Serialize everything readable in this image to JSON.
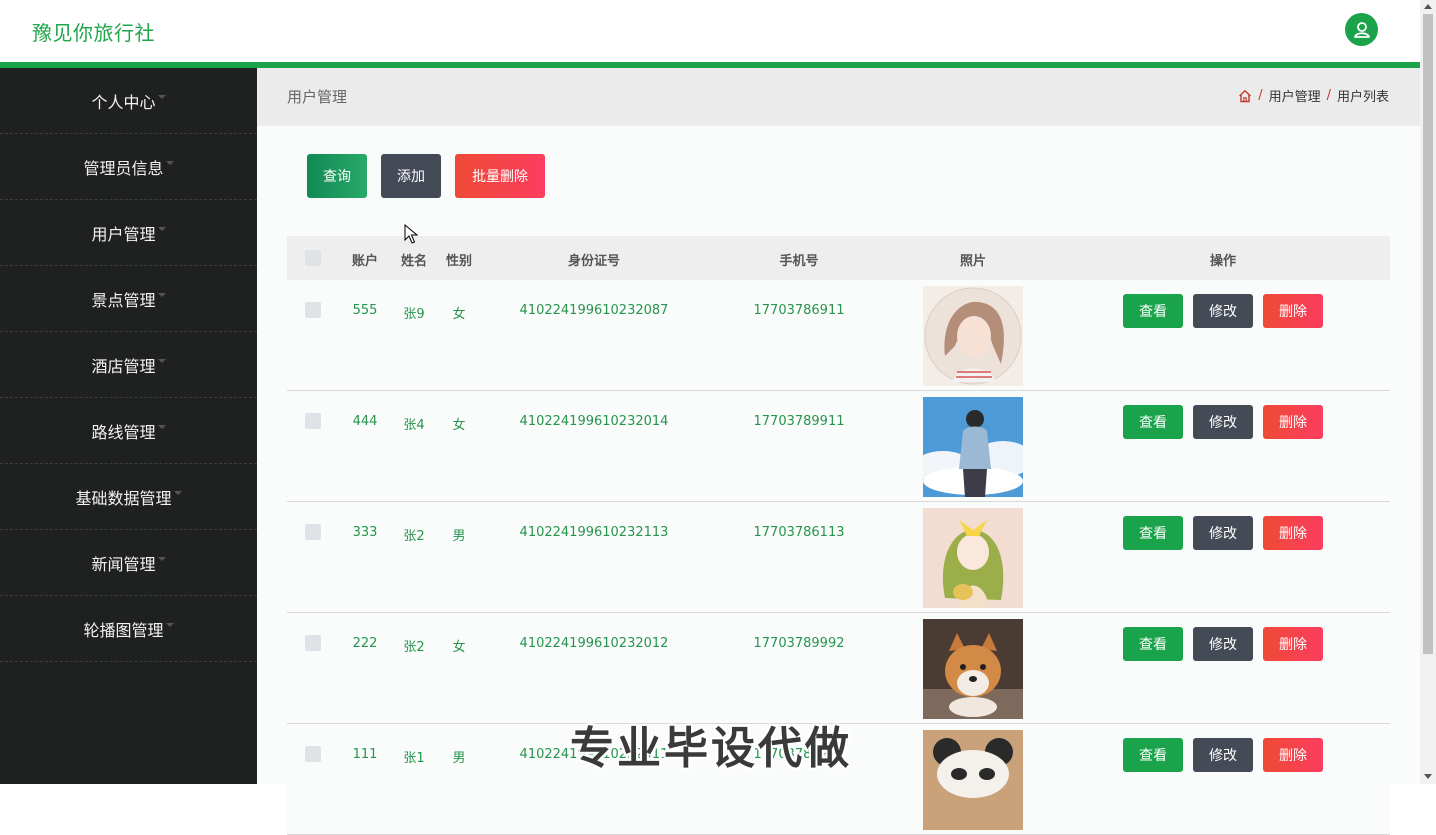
{
  "header": {
    "brand": "豫见你旅行社",
    "avatar_icon": "user-icon",
    "accent": "#1aa34a"
  },
  "sidebar": {
    "items": [
      {
        "label": "个人中心"
      },
      {
        "label": "管理员信息"
      },
      {
        "label": "用户管理"
      },
      {
        "label": "景点管理"
      },
      {
        "label": "酒店管理"
      },
      {
        "label": "路线管理"
      },
      {
        "label": "基础数据管理"
      },
      {
        "label": "新闻管理"
      },
      {
        "label": "轮播图管理"
      }
    ]
  },
  "page": {
    "title": "用户管理",
    "breadcrumb": {
      "home_icon": "home-icon",
      "sep": "/",
      "level1": "用户管理",
      "level2": "用户列表"
    }
  },
  "toolbar": {
    "query_label": "查询",
    "add_label": "添加",
    "batch_delete_label": "批量删除"
  },
  "table": {
    "columns": {
      "account": "账户",
      "name": "姓名",
      "gender": "性别",
      "id_number": "身份证号",
      "phone": "手机号",
      "photo": "照片",
      "actions": "操作"
    },
    "action_labels": {
      "view": "查看",
      "edit": "修改",
      "delete": "删除"
    },
    "rows": [
      {
        "account": "555",
        "name": "张9",
        "gender": "女",
        "id_number": "410224199610232087",
        "phone": "17703786911",
        "photo": "portrait-girl"
      },
      {
        "account": "444",
        "name": "张4",
        "gender": "女",
        "id_number": "410224199610232014",
        "phone": "17703789911",
        "photo": "boy-sky"
      },
      {
        "account": "333",
        "name": "张2",
        "gender": "男",
        "id_number": "410224199610232113",
        "phone": "17703786113",
        "photo": "anime-girl"
      },
      {
        "account": "222",
        "name": "张2",
        "gender": "女",
        "id_number": "410224199610232012",
        "phone": "17703789992",
        "photo": "shiba-dog"
      },
      {
        "account": "111",
        "name": "张1",
        "gender": "男",
        "id_number": "410224199610232011",
        "phone": "17703786911",
        "photo": "panda-hat"
      }
    ]
  },
  "watermark": "专业毕设代做"
}
